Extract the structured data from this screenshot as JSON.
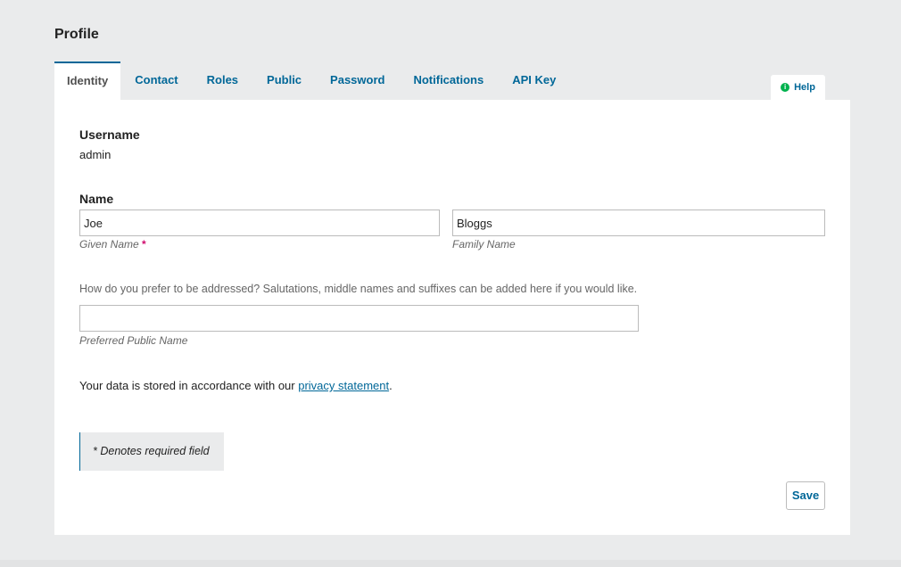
{
  "page": {
    "title": "Profile"
  },
  "tabs": [
    {
      "label": "Identity",
      "active": true
    },
    {
      "label": "Contact"
    },
    {
      "label": "Roles"
    },
    {
      "label": "Public"
    },
    {
      "label": "Password"
    },
    {
      "label": "Notifications"
    },
    {
      "label": "API Key"
    }
  ],
  "help": {
    "label": "Help",
    "icon": "info-icon"
  },
  "form": {
    "username_label": "Username",
    "username_value": "admin",
    "name_label": "Name",
    "given_name_value": "Joe",
    "given_name_label": "Given Name",
    "required_marker": "*",
    "family_name_value": "Bloggs",
    "family_name_label": "Family Name",
    "preferred_desc": "How do you prefer to be addressed? Salutations, middle names and suffixes can be added here if you would like.",
    "preferred_value": "",
    "preferred_label": "Preferred Public Name",
    "privacy_prefix": "Your data is stored in accordance with our ",
    "privacy_link": "privacy statement",
    "privacy_suffix": ".",
    "required_notice": "* Denotes required field",
    "save_label": "Save"
  },
  "colors": {
    "accent": "#006798",
    "required": "#d00a6c",
    "help_icon": "#00b24e",
    "background": "#eaebec"
  }
}
